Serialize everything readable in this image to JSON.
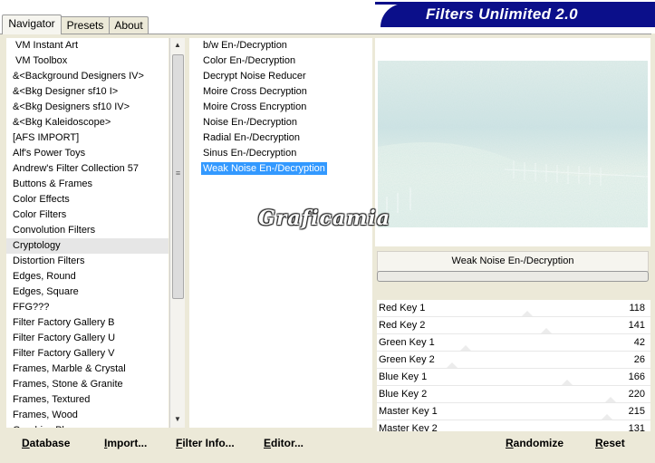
{
  "tabs": [
    {
      "label": "Navigator"
    },
    {
      "label": "Presets"
    },
    {
      "label": "About"
    }
  ],
  "banner_title": "Filters Unlimited 2.0",
  "categories": [
    "VM Instant Art",
    "VM Toolbox",
    "&<Background Designers IV>",
    "&<Bkg Designer sf10 I>",
    "&<Bkg Designers sf10 IV>",
    "&<Bkg Kaleidoscope>",
    "[AFS IMPORT]",
    "Alf's Power Toys",
    "Andrew's Filter Collection 57",
    "Buttons & Frames",
    "Color Effects",
    "Color Filters",
    "Convolution Filters",
    "Cryptology",
    "Distortion Filters",
    "Edges, Round",
    "Edges, Square",
    "FFG???",
    "Filter Factory Gallery B",
    "Filter Factory Gallery U",
    "Filter Factory Gallery V",
    "Frames, Marble & Crystal",
    "Frames, Stone & Granite",
    "Frames, Textured",
    "Frames, Wood",
    "Graphics Plus"
  ],
  "selected_category": "Cryptology",
  "filters": [
    "b/w En-/Decryption",
    "Color En-/Decryption",
    "Decrypt Noise Reducer",
    "Moire Cross Decryption",
    "Moire Cross Encryption",
    "Noise En-/Decryption",
    "Radial En-/Decryption",
    "Sinus En-/Decryption",
    "Weak Noise En-/Decryption"
  ],
  "selected_filter": "Weak Noise En-/Decryption",
  "watermark_text": "Graficamia",
  "preview_filter_name": "Weak Noise En-/Decryption",
  "sliders": [
    {
      "label": "Red Key 1",
      "value": 118
    },
    {
      "label": "Red Key 2",
      "value": 141
    },
    {
      "label": "Green Key 1",
      "value": 42
    },
    {
      "label": "Green Key 2",
      "value": 26
    },
    {
      "label": "Blue Key 1",
      "value": 166
    },
    {
      "label": "Blue Key 2",
      "value": 220
    },
    {
      "label": "Master Key 1",
      "value": 215
    },
    {
      "label": "Master Key 2",
      "value": 131
    }
  ],
  "slider_max": 255,
  "buttons": {
    "database": {
      "first": "D",
      "rest": "atabase"
    },
    "import": {
      "first": "I",
      "rest": "mport..."
    },
    "filter_info": {
      "first": "F",
      "rest": "ilter Info..."
    },
    "editor": {
      "first": "E",
      "rest": "ditor..."
    },
    "randomize": {
      "first": "R",
      "rest": "andomize"
    },
    "reset": {
      "first": "R",
      "rest": "eset"
    }
  },
  "colors": {
    "banner": "#0b0f8a",
    "selection": "#3399ff",
    "panel": "#ece9d8"
  }
}
